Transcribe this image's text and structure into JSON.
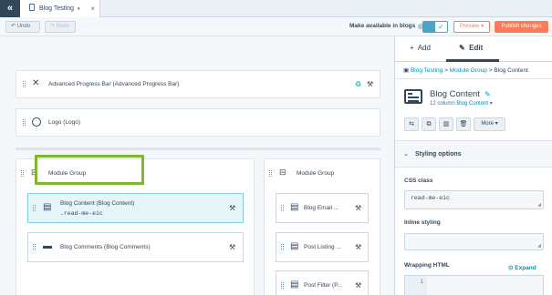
{
  "tabbar": {
    "back_icon": "double-chevron-left-icon",
    "tab_label": "Blog Testing",
    "tab_caret": "▾",
    "close": "×"
  },
  "toolbar": {
    "undo_label": "Undo",
    "redo_label": "Redo",
    "availability_label": "Make available in blogs",
    "availability_enabled": true,
    "preview_label": "Preview",
    "publish_label": "Publish changes",
    "accent_color": "#ff7a59",
    "toggle_color": "#4aa4c6"
  },
  "canvas": {
    "row1_label": "Advanced Progress Bar (Advanced Progress Bar)",
    "row2_label": "Logo (Logo)",
    "group_left_label": "Module Group",
    "group_right_label": "Module Group",
    "blog_content_label": "Blog Content (Blog Content)",
    "blog_content_class": ".read-me-eic",
    "blog_comments_label": "Blog Comments (Blog Comments)",
    "right_modules": [
      "Blog Email ...",
      "Post Listing ...",
      "Post Filter (P..."
    ],
    "selection_color": "#7fb82f"
  },
  "panel": {
    "tab_add": "Add",
    "tab_edit": "Edit",
    "breadcrumb": [
      "Blog Testing",
      "Module Group",
      "Blog Content"
    ],
    "breadcrumb_sep": ">",
    "module_title": "Blog Content",
    "module_sub_prefix": "12 column",
    "module_sub_link": "Blog Content",
    "more_label": "More",
    "section_title": "Styling options",
    "css_class_label": "CSS class",
    "css_class_value": "read-me-eic",
    "inline_label": "Inline styling",
    "inline_value": "",
    "wrapping_label": "Wrapping HTML",
    "expand_label": "Expand",
    "line_number": "1"
  }
}
